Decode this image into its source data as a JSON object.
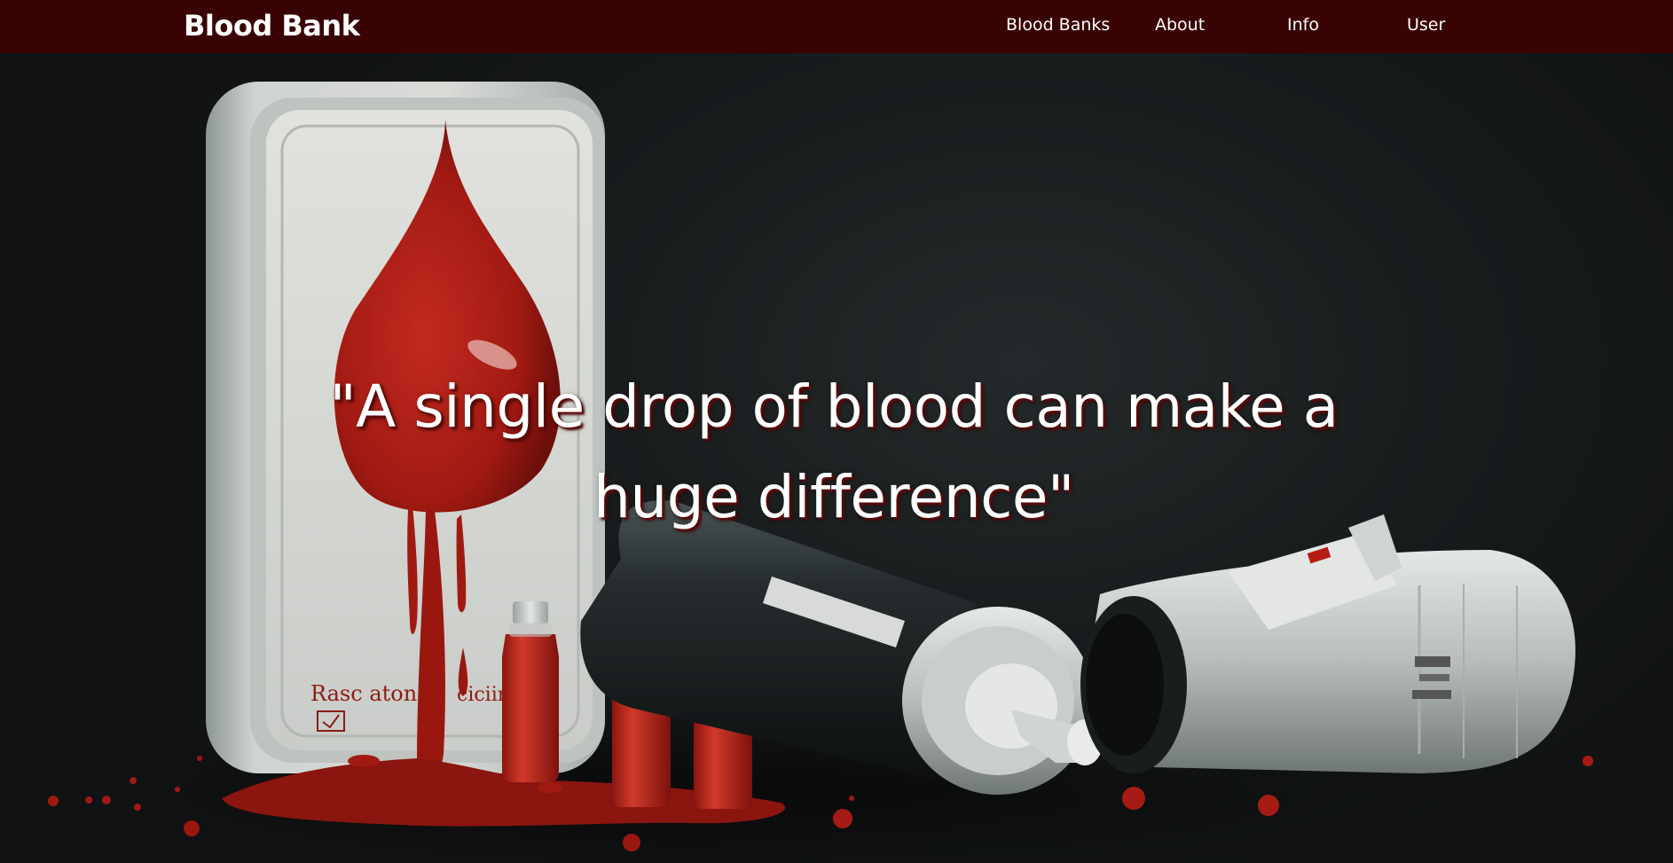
{
  "navbar": {
    "brand": "Blood Bank",
    "links": [
      {
        "label": "Blood Banks"
      },
      {
        "label": "About"
      },
      {
        "label": "Info"
      },
      {
        "label": "User"
      }
    ]
  },
  "hero": {
    "quote": "\"A single drop of blood can make a huge difference\"",
    "image_text": {
      "container_label": "Rasc aton",
      "container_label_right": "ciciir"
    }
  },
  "colors": {
    "navbar_bg": "#3a0303",
    "blood_red": "#a81a14",
    "hero_bg": "#141617",
    "text": "#ffffff"
  }
}
